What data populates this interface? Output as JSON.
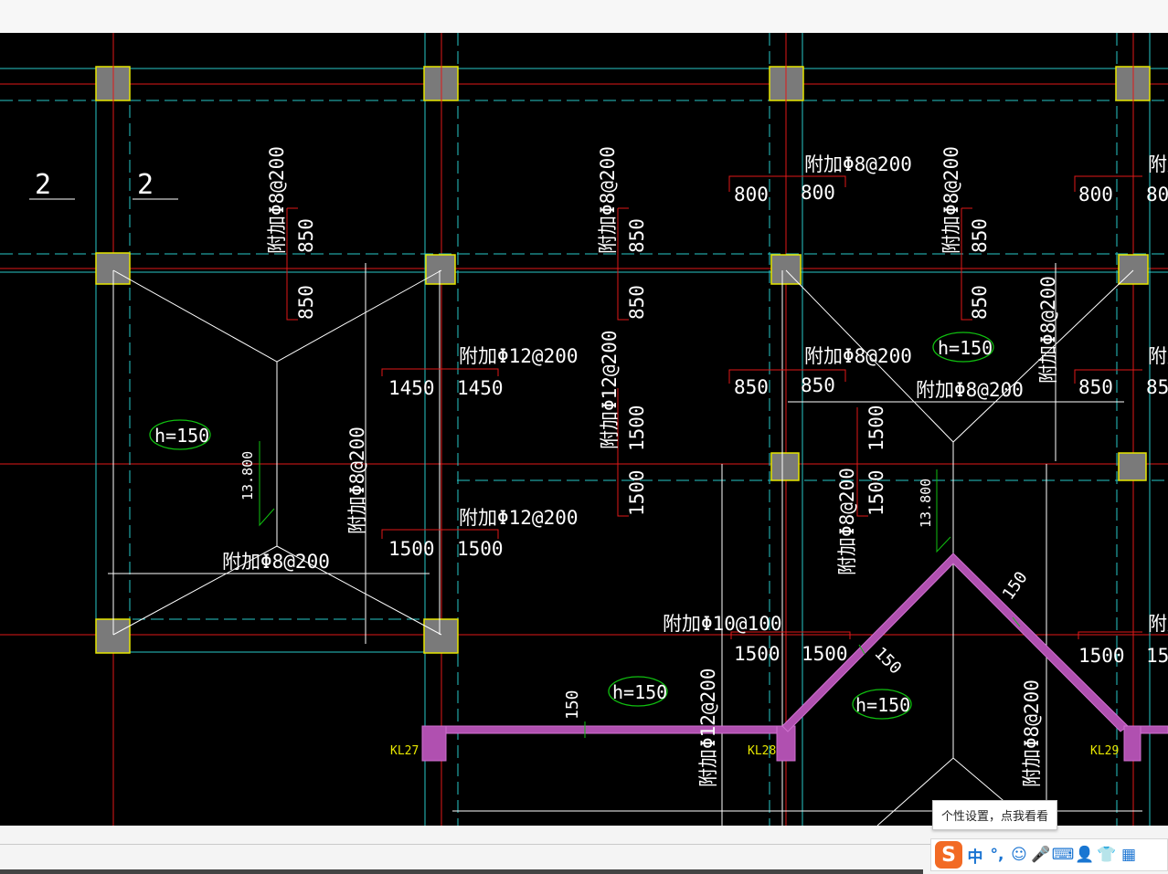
{
  "labels": {
    "section_2a": "2",
    "section_2b": "2",
    "rebar_8_200": "附加Φ8@200",
    "rebar_12_200": "附加Φ12@200",
    "rebar_10_100": "附加Φ10@100",
    "rebar_partial": "附加",
    "h150": "h=150",
    "elev": "13.800",
    "kl27": "KL27",
    "kl28": "KL28",
    "kl29": "KL29",
    "d800": "800",
    "d850": "850",
    "d1450": "1450",
    "d1500": "1500",
    "d150": "150",
    "d_cut_80": "80",
    "d_cut_85": "85",
    "d_cut_15": "15"
  },
  "tooltip": "个性设置，点我看看",
  "ime": {
    "logo": "S",
    "lang": "中",
    "punct": "°,",
    "emoji": "☺",
    "mic": "🎤",
    "keyboard": "⌨",
    "user": "👤",
    "shirt": "👕",
    "grid": "▦"
  },
  "colors": {
    "canvas_bg": "#000000",
    "axis_red": "#e01818",
    "beam_cyan": "#28c8c8",
    "column_gray": "#7a7a7a",
    "column_yellow": "#e6e600",
    "text_white": "#ffffff",
    "oval_green": "#10c010",
    "label_yellow": "#e6e600",
    "hatch_magenta": "#c060c0"
  }
}
